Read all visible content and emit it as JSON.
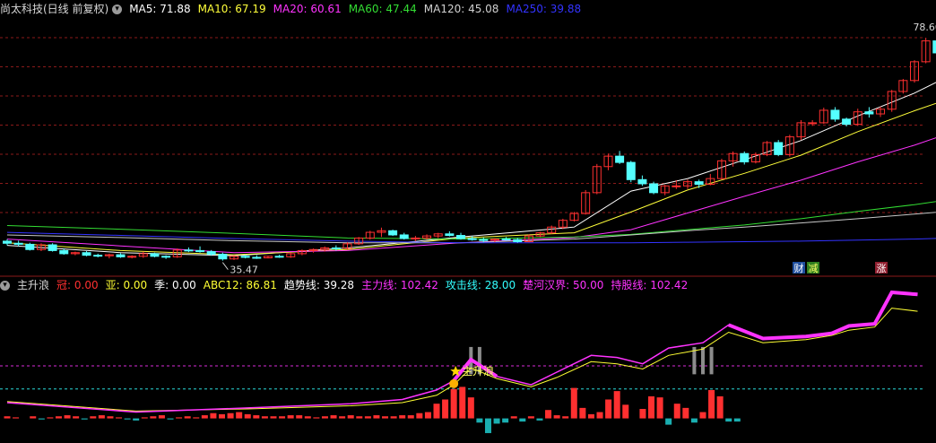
{
  "main_header": {
    "title": "尚太科技(日线 前复权)",
    "ma": [
      {
        "label": "MA5: 71.88",
        "color": "#ffffff"
      },
      {
        "label": "MA10: 67.19",
        "color": "#ffff3a"
      },
      {
        "label": "MA20: 60.61",
        "color": "#ff33ff"
      },
      {
        "label": "MA60: 47.44",
        "color": "#33dd33"
      },
      {
        "label": "MA120: 45.08",
        "color": "#d0d0d0"
      },
      {
        "label": "MA250: 39.88",
        "color": "#3333ff"
      }
    ]
  },
  "sub_header": {
    "title": "主升浪",
    "items": [
      {
        "label": "冠: 0.00",
        "color": "#ff3030"
      },
      {
        "label": "亚: 0.00",
        "color": "#ffff33"
      },
      {
        "label": "季: 0.00",
        "color": "#ffffff"
      },
      {
        "label": "ABC12: 86.81",
        "color": "#ffff33"
      },
      {
        "label": "趋势线: 39.28",
        "color": "#ffffff"
      },
      {
        "label": "主力线: 102.42",
        "color": "#ff33ff"
      },
      {
        "label": "攻击线: 28.00",
        "color": "#33ffff"
      },
      {
        "label": "楚河汉界: 50.00",
        "color": "#ff33ff"
      },
      {
        "label": "持股线: 102.42",
        "color": "#ff33ff"
      }
    ]
  },
  "annotations": {
    "high_label": "78.60",
    "low_label": "35.47",
    "signal_label": "主升浪",
    "badges": [
      {
        "text": "财",
        "bg": "#1f4f9f",
        "color": "#ffffff"
      },
      {
        "text": "减",
        "bg": "#2f7f1f",
        "color": "#ffff66"
      },
      {
        "text": "涨",
        "bg": "#8f1f2f",
        "color": "#ffffff"
      }
    ]
  },
  "colors": {
    "up": "#ff3030",
    "down": "#54ffff",
    "grid": "#8b1a1a",
    "panel_border": "#8b1a1a",
    "magenta": "#ff33ff",
    "cyan_line": "#33ffff"
  },
  "chart_data": [
    {
      "type": "candlestick",
      "title": "尚太科技(日线 前复权)",
      "ylim": [
        33,
        82
      ],
      "grid": true,
      "candles": [
        [
          39.2,
          39.6,
          38.4,
          38.8
        ],
        [
          38.8,
          39.3,
          38.2,
          38.6
        ],
        [
          38.6,
          38.9,
          37.4,
          37.6
        ],
        [
          37.6,
          38.8,
          37.3,
          38.5
        ],
        [
          38.5,
          38.8,
          37.2,
          37.4
        ],
        [
          37.4,
          37.8,
          36.6,
          36.8
        ],
        [
          36.8,
          37.2,
          36.5,
          37.0
        ],
        [
          37.0,
          37.3,
          36.3,
          36.5
        ],
        [
          36.5,
          36.8,
          36.1,
          36.4
        ],
        [
          36.4,
          36.8,
          35.9,
          36.6
        ],
        [
          36.6,
          36.9,
          36.0,
          36.2
        ],
        [
          36.2,
          36.5,
          35.9,
          36.3
        ],
        [
          36.3,
          37.2,
          36.0,
          36.8
        ],
        [
          36.8,
          37.0,
          36.1,
          36.3
        ],
        [
          36.3,
          36.5,
          35.8,
          36.2
        ],
        [
          36.2,
          37.8,
          36.0,
          37.5
        ],
        [
          37.5,
          38.0,
          37.1,
          37.4
        ],
        [
          37.4,
          38.2,
          37.0,
          37.2
        ],
        [
          37.2,
          37.5,
          36.4,
          36.7
        ],
        [
          36.7,
          37.0,
          35.47,
          35.8
        ],
        [
          35.8,
          36.4,
          35.6,
          36.3
        ],
        [
          36.3,
          36.6,
          35.9,
          36.1
        ],
        [
          36.1,
          36.5,
          35.8,
          36.0
        ],
        [
          36.0,
          36.4,
          35.9,
          36.3
        ],
        [
          36.3,
          36.6,
          36.0,
          36.2
        ],
        [
          36.2,
          37.0,
          36.0,
          36.8
        ],
        [
          36.8,
          37.6,
          36.5,
          37.4
        ],
        [
          37.4,
          37.8,
          37.0,
          37.6
        ],
        [
          37.6,
          38.2,
          37.2,
          37.9
        ],
        [
          37.9,
          38.4,
          37.4,
          37.8
        ],
        [
          37.8,
          39.0,
          37.6,
          38.7
        ],
        [
          38.7,
          40.0,
          38.5,
          39.8
        ],
        [
          39.8,
          41.2,
          39.5,
          40.9
        ],
        [
          40.9,
          41.8,
          40.0,
          41.2
        ],
        [
          41.2,
          41.4,
          40.2,
          40.4
        ],
        [
          40.4,
          40.8,
          39.5,
          39.7
        ],
        [
          39.7,
          40.2,
          39.2,
          39.8
        ],
        [
          39.8,
          40.5,
          39.5,
          40.2
        ],
        [
          40.2,
          40.8,
          39.8,
          40.6
        ],
        [
          40.6,
          41.1,
          40.1,
          40.3
        ],
        [
          40.3,
          40.8,
          39.5,
          39.7
        ],
        [
          39.7,
          40.2,
          39.3,
          39.5
        ],
        [
          39.5,
          39.9,
          39.0,
          39.4
        ],
        [
          39.4,
          39.8,
          39.0,
          39.6
        ],
        [
          39.6,
          40.0,
          39.3,
          39.5
        ],
        [
          39.5,
          39.8,
          38.9,
          39.1
        ],
        [
          39.1,
          40.5,
          39.0,
          40.2
        ],
        [
          40.2,
          41.0,
          40.0,
          40.8
        ],
        [
          40.8,
          42.2,
          40.6,
          41.9
        ],
        [
          41.9,
          43.5,
          41.5,
          43.2
        ],
        [
          43.2,
          44.8,
          43.0,
          44.5
        ],
        [
          44.5,
          49.0,
          44.3,
          48.5
        ],
        [
          48.5,
          54.0,
          48.2,
          53.5
        ],
        [
          53.5,
          56.0,
          52.8,
          55.5
        ],
        [
          55.5,
          56.5,
          54.0,
          54.3
        ],
        [
          54.3,
          54.6,
          50.5,
          51.0
        ],
        [
          51.0,
          51.8,
          49.8,
          50.2
        ],
        [
          50.2,
          50.6,
          48.2,
          48.5
        ],
        [
          48.5,
          50.0,
          48.0,
          49.8
        ],
        [
          49.8,
          50.9,
          49.2,
          49.8
        ],
        [
          49.8,
          51.0,
          49.2,
          50.6
        ],
        [
          50.6,
          51.0,
          49.4,
          50.1
        ],
        [
          50.1,
          52.1,
          49.9,
          51.2
        ],
        [
          51.2,
          55.0,
          51.0,
          54.6
        ],
        [
          54.6,
          56.4,
          53.5,
          56.0
        ],
        [
          56.0,
          56.4,
          53.9,
          54.4
        ],
        [
          54.4,
          56.2,
          54.1,
          55.8
        ],
        [
          55.8,
          58.4,
          55.5,
          58.1
        ],
        [
          58.1,
          58.6,
          55.5,
          55.8
        ],
        [
          55.8,
          59.6,
          55.4,
          59.2
        ],
        [
          59.2,
          62.4,
          58.6,
          61.9
        ],
        [
          61.9,
          62.4,
          61.3,
          61.9
        ],
        [
          61.9,
          64.8,
          61.7,
          64.3
        ],
        [
          64.3,
          64.9,
          62.1,
          62.6
        ],
        [
          62.6,
          62.9,
          61.2,
          61.6
        ],
        [
          61.6,
          64.6,
          61.3,
          64.0
        ],
        [
          64.0,
          64.9,
          62.9,
          63.6
        ],
        [
          63.6,
          65.0,
          63.0,
          64.5
        ],
        [
          64.5,
          68.2,
          64.0,
          67.9
        ],
        [
          67.9,
          70.3,
          67.5,
          70.0
        ],
        [
          70.0,
          73.9,
          69.6,
          73.6
        ],
        [
          73.6,
          78.2,
          73.3,
          77.6
        ],
        [
          77.6,
          78.0,
          75.0,
          75.3
        ],
        [
          75.3,
          78.5,
          75.0,
          78.0
        ],
        [
          78.0,
          78.6,
          73.8,
          74.5
        ]
      ],
      "ma": {
        "MA5": [
          [
            0,
            38.4
          ],
          [
            10,
            37.0
          ],
          [
            20,
            36.4
          ],
          [
            30,
            37.9
          ],
          [
            40,
            40.0
          ],
          [
            50,
            41.9
          ],
          [
            55,
            48.8
          ],
          [
            60,
            51.2
          ],
          [
            65,
            54.8
          ],
          [
            70,
            58.5
          ],
          [
            75,
            63.2
          ],
          [
            80,
            67.6
          ],
          [
            84,
            71.88
          ]
        ],
        "MA10": [
          [
            0,
            38.9
          ],
          [
            10,
            37.4
          ],
          [
            20,
            36.6
          ],
          [
            30,
            37.6
          ],
          [
            40,
            39.8
          ],
          [
            50,
            40.8
          ],
          [
            55,
            44.8
          ],
          [
            60,
            49.0
          ],
          [
            65,
            52.2
          ],
          [
            70,
            55.7
          ],
          [
            75,
            60.2
          ],
          [
            80,
            64.2
          ],
          [
            84,
            67.19
          ]
        ],
        "MA20": [
          [
            0,
            39.6
          ],
          [
            10,
            38.3
          ],
          [
            20,
            37.0
          ],
          [
            30,
            37.4
          ],
          [
            40,
            38.9
          ],
          [
            50,
            39.9
          ],
          [
            55,
            41.4
          ],
          [
            60,
            44.6
          ],
          [
            65,
            47.8
          ],
          [
            70,
            50.9
          ],
          [
            75,
            54.4
          ],
          [
            80,
            57.6
          ],
          [
            84,
            60.61
          ]
        ],
        "MA60": [
          [
            0,
            42.2
          ],
          [
            10,
            41.5
          ],
          [
            20,
            40.7
          ],
          [
            30,
            39.8
          ],
          [
            40,
            39.6
          ],
          [
            50,
            40.0
          ],
          [
            55,
            40.5
          ],
          [
            60,
            41.4
          ],
          [
            65,
            42.3
          ],
          [
            70,
            43.5
          ],
          [
            75,
            44.9
          ],
          [
            80,
            46.2
          ],
          [
            84,
            47.44
          ]
        ],
        "MA120": [
          [
            0,
            40.4
          ],
          [
            10,
            39.9
          ],
          [
            20,
            39.3
          ],
          [
            30,
            38.9
          ],
          [
            40,
            38.9
          ],
          [
            50,
            39.6
          ],
          [
            55,
            40.4
          ],
          [
            60,
            41.2
          ],
          [
            65,
            41.9
          ],
          [
            70,
            42.7
          ],
          [
            75,
            43.5
          ],
          [
            80,
            44.4
          ],
          [
            84,
            45.08
          ]
        ],
        "MA250": [
          [
            0,
            40.9
          ],
          [
            10,
            40.3
          ],
          [
            20,
            39.7
          ],
          [
            30,
            39.2
          ],
          [
            40,
            38.9
          ],
          [
            50,
            38.9
          ],
          [
            55,
            38.9
          ],
          [
            60,
            39.0
          ],
          [
            65,
            39.1
          ],
          [
            70,
            39.2
          ],
          [
            75,
            39.4
          ],
          [
            80,
            39.6
          ],
          [
            84,
            39.88
          ]
        ]
      },
      "high_marker": {
        "index": 83,
        "value": 78.6
      },
      "low_marker": {
        "index": 19,
        "value": 35.47
      }
    },
    {
      "type": "indicator",
      "title": "主升浪",
      "ylim": [
        -20,
        120
      ],
      "ref_lines": [
        {
          "name": "楚河汉界",
          "value": 50.0,
          "color": "#ff33ff"
        },
        {
          "name": "攻击线",
          "value": 28.0,
          "color": "#33ffff"
        }
      ],
      "bars": [
        2,
        1,
        0,
        2,
        -1,
        1,
        2,
        3,
        2,
        -1,
        2,
        3,
        2,
        1,
        -1,
        -2,
        1,
        2,
        3,
        -1,
        1,
        2,
        1,
        3,
        5,
        4,
        5,
        6,
        4,
        3,
        2,
        2,
        2,
        3,
        3,
        2,
        1,
        2,
        3,
        2,
        3,
        2,
        2,
        3,
        2,
        2,
        3,
        3,
        5,
        6,
        14,
        18,
        28,
        30,
        20,
        -4,
        -14,
        -5,
        -4,
        2,
        -3,
        2,
        -2,
        8,
        3,
        2,
        29,
        10,
        4,
        6,
        18,
        26,
        13,
        0,
        9,
        21,
        20,
        -6,
        14,
        10,
        -4,
        6,
        27,
        21,
        -3,
        -3
      ],
      "main_line": [
        [
          0,
          15
        ],
        [
          15,
          6
        ],
        [
          28,
          10
        ],
        [
          40,
          14
        ],
        [
          46,
          18
        ],
        [
          50,
          27
        ],
        [
          52,
          36
        ],
        [
          54,
          56
        ],
        [
          57,
          40
        ],
        [
          61,
          32
        ],
        [
          64,
          44
        ],
        [
          68,
          60
        ],
        [
          71,
          58
        ],
        [
          74,
          52
        ],
        [
          77,
          67
        ],
        [
          81,
          72
        ],
        [
          84,
          89
        ],
        [
          88,
          76
        ],
        [
          93,
          78
        ],
        [
          96,
          81
        ],
        [
          98,
          88
        ],
        [
          101,
          90
        ],
        [
          103,
          120
        ],
        [
          106,
          118
        ]
      ],
      "trend_line": [
        [
          0,
          16
        ],
        [
          15,
          7
        ],
        [
          28,
          9
        ],
        [
          40,
          12
        ],
        [
          46,
          15
        ],
        [
          50,
          22
        ],
        [
          52,
          32
        ],
        [
          54,
          48
        ],
        [
          57,
          38
        ],
        [
          61,
          30
        ],
        [
          64,
          39
        ],
        [
          68,
          54
        ],
        [
          71,
          52
        ],
        [
          74,
          47
        ],
        [
          77,
          60
        ],
        [
          81,
          66
        ],
        [
          84,
          82
        ],
        [
          88,
          72
        ],
        [
          93,
          75
        ],
        [
          96,
          79
        ],
        [
          98,
          84
        ],
        [
          101,
          87
        ],
        [
          103,
          105
        ],
        [
          106,
          102
        ]
      ],
      "gray_signals": [
        54,
        55,
        80,
        81,
        82
      ],
      "signal_index": 52
    }
  ]
}
